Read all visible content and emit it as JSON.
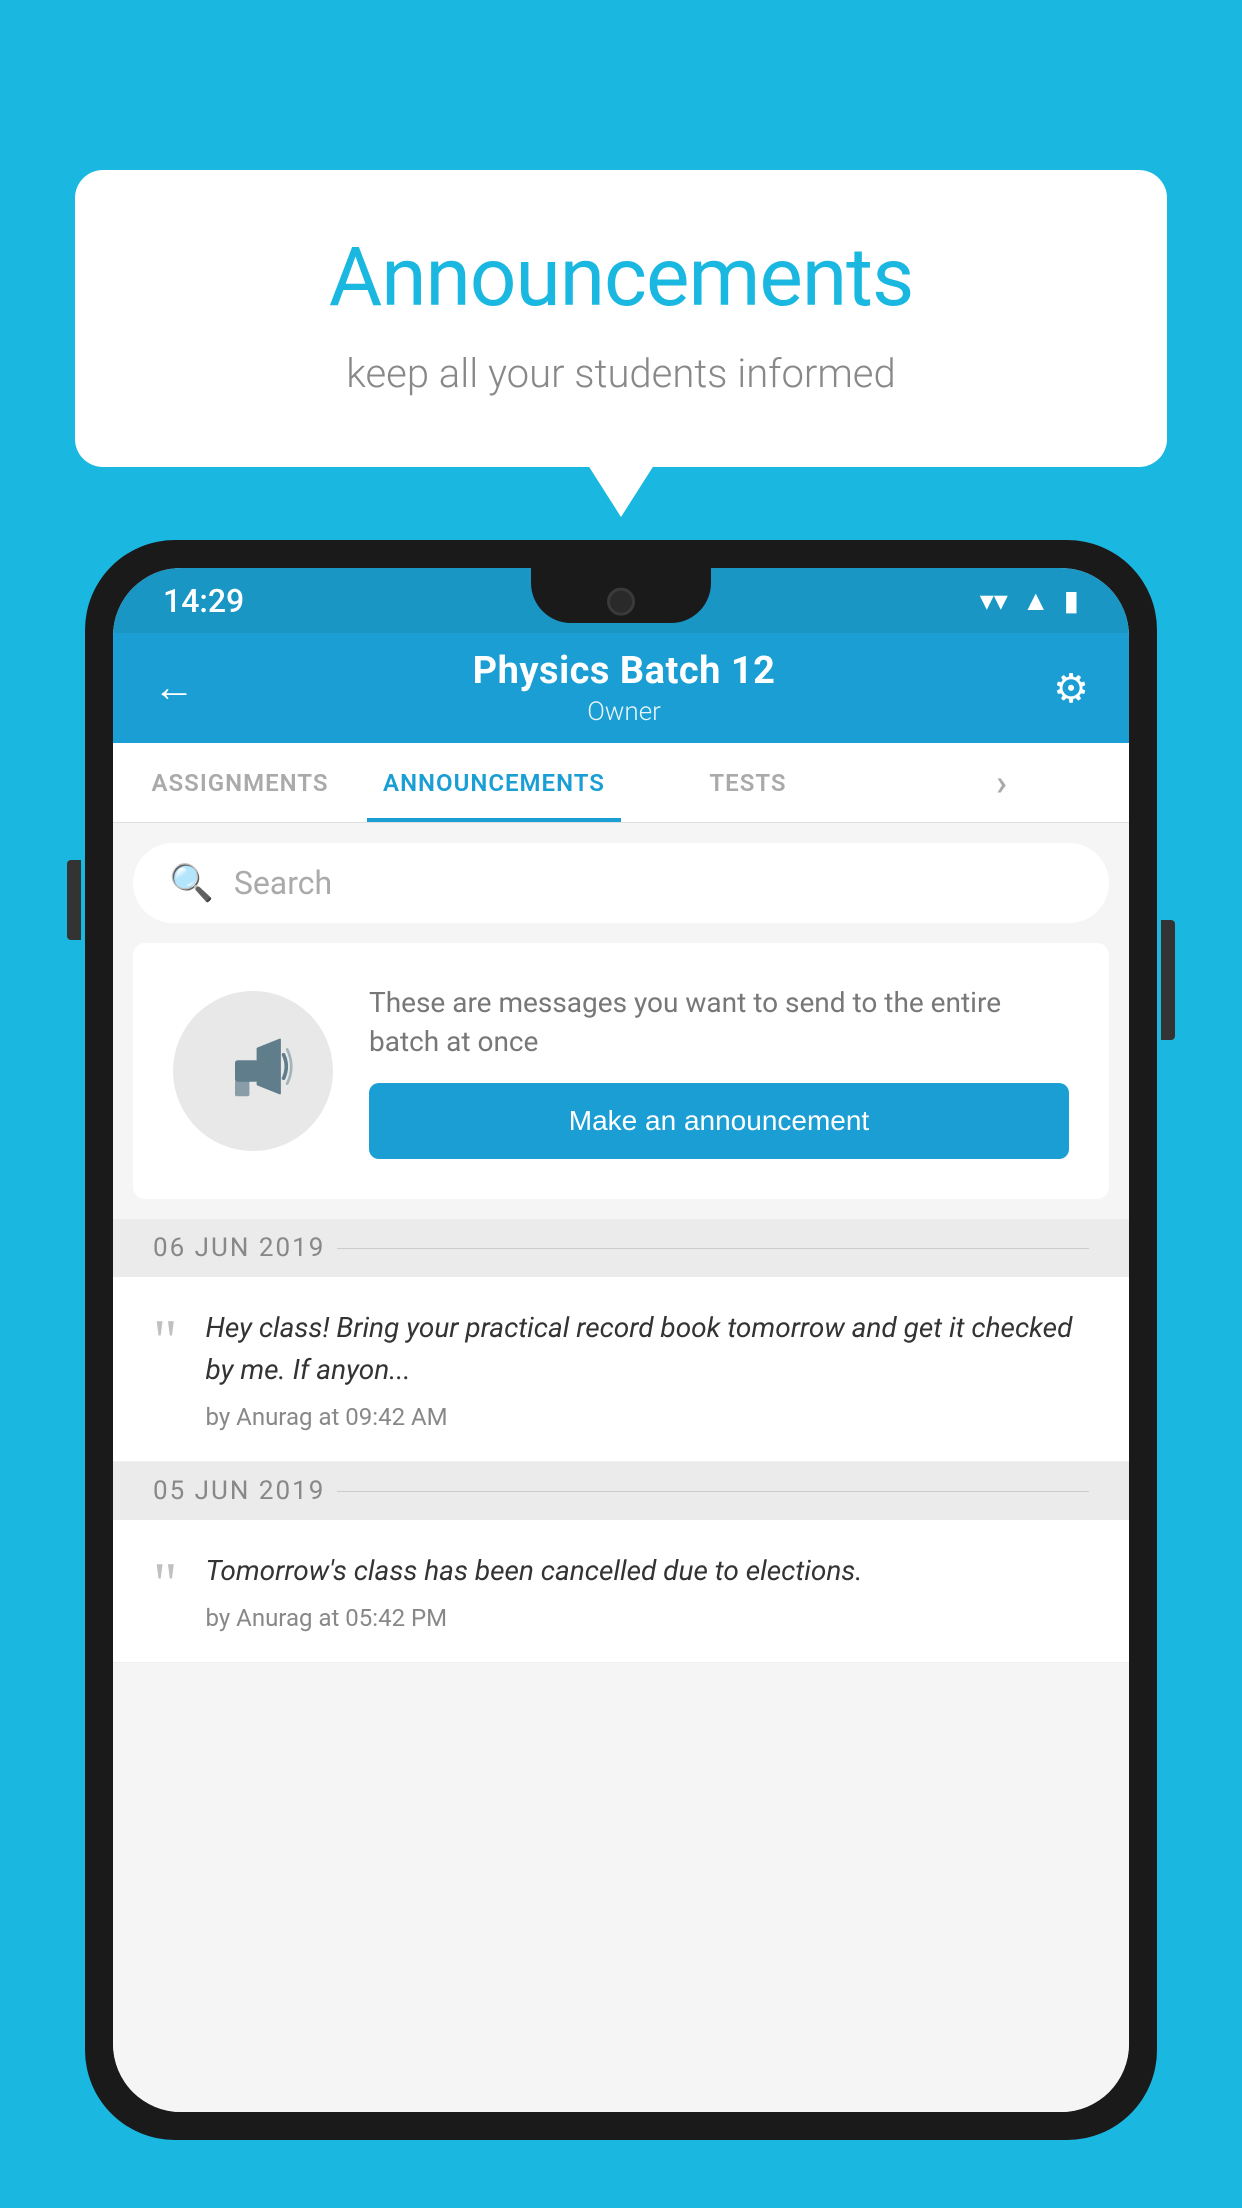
{
  "page": {
    "background_color": "#1ab8e0"
  },
  "speech_bubble": {
    "title": "Announcements",
    "subtitle": "keep all your students informed"
  },
  "status_bar": {
    "time": "14:29",
    "wifi_symbol": "▼",
    "signal_symbol": "▲",
    "battery_symbol": "▮"
  },
  "app_header": {
    "back_label": "←",
    "title": "Physics Batch 12",
    "subtitle": "Owner",
    "gear_symbol": "⚙"
  },
  "tabs": [
    {
      "label": "ASSIGNMENTS",
      "active": false
    },
    {
      "label": "ANNOUNCEMENTS",
      "active": true
    },
    {
      "label": "TESTS",
      "active": false
    },
    {
      "label": "›",
      "active": false,
      "partial": true
    }
  ],
  "search": {
    "placeholder": "Search"
  },
  "announcement_prompt": {
    "description_text": "These are messages you want to send to the entire batch at once",
    "button_label": "Make an announcement"
  },
  "dates": [
    {
      "label": "06  JUN  2019",
      "announcements": [
        {
          "text": "Hey class! Bring your practical record book tomorrow and get it checked by me. If anyon...",
          "meta": "by Anurag at 09:42 AM"
        }
      ]
    },
    {
      "label": "05  JUN  2019",
      "announcements": [
        {
          "text": "Tomorrow's class has been cancelled due to elections.",
          "meta": "by Anurag at 05:42 PM"
        }
      ]
    }
  ]
}
